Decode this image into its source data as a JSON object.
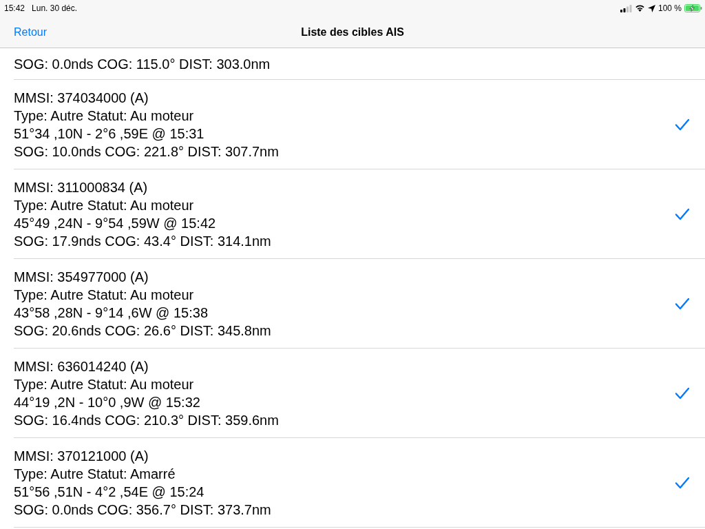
{
  "status_bar": {
    "time": "15:42",
    "date": "Lun. 30 déc.",
    "battery": "100 %",
    "charging": true
  },
  "nav_bar": {
    "back": "Retour",
    "title": "Liste des cibles AIS"
  },
  "partial_row": {
    "lines": [
      "SOG: 0.0nds COG: 115.0° DIST: 303.0nm"
    ]
  },
  "targets": [
    {
      "mmsi": "MMSI: 374034000 (A)",
      "type_status": "Type: Autre Statut: Au moteur",
      "position": "51°34 ,10N - 2°6 ,59E @ 15:31",
      "motion": "SOG: 10.0nds COG: 221.8° DIST: 307.7nm",
      "checked": true
    },
    {
      "mmsi": "MMSI: 311000834 (A)",
      "type_status": "Type: Autre Statut: Au moteur",
      "position": "45°49 ,24N - 9°54 ,59W @ 15:42",
      "motion": "SOG: 17.9nds COG: 43.4° DIST: 314.1nm",
      "checked": true
    },
    {
      "mmsi": "MMSI: 354977000 (A)",
      "type_status": "Type: Autre Statut: Au moteur",
      "position": "43°58 ,28N - 9°14 ,6W @ 15:38",
      "motion": "SOG: 20.6nds COG: 26.6° DIST: 345.8nm",
      "checked": true
    },
    {
      "mmsi": "MMSI: 636014240 (A)",
      "type_status": "Type: Autre Statut: Au moteur",
      "position": "44°19 ,2N - 10°0 ,9W @ 15:32",
      "motion": "SOG: 16.4nds COG: 210.3° DIST: 359.6nm",
      "checked": true
    },
    {
      "mmsi": "MMSI: 370121000 (A)",
      "type_status": "Type: Autre Statut: Amarré",
      "position": "51°56 ,51N - 4°2 ,54E @ 15:24",
      "motion": "SOG: 0.0nds COG: 356.7° DIST: 373.7nm",
      "checked": true
    }
  ]
}
